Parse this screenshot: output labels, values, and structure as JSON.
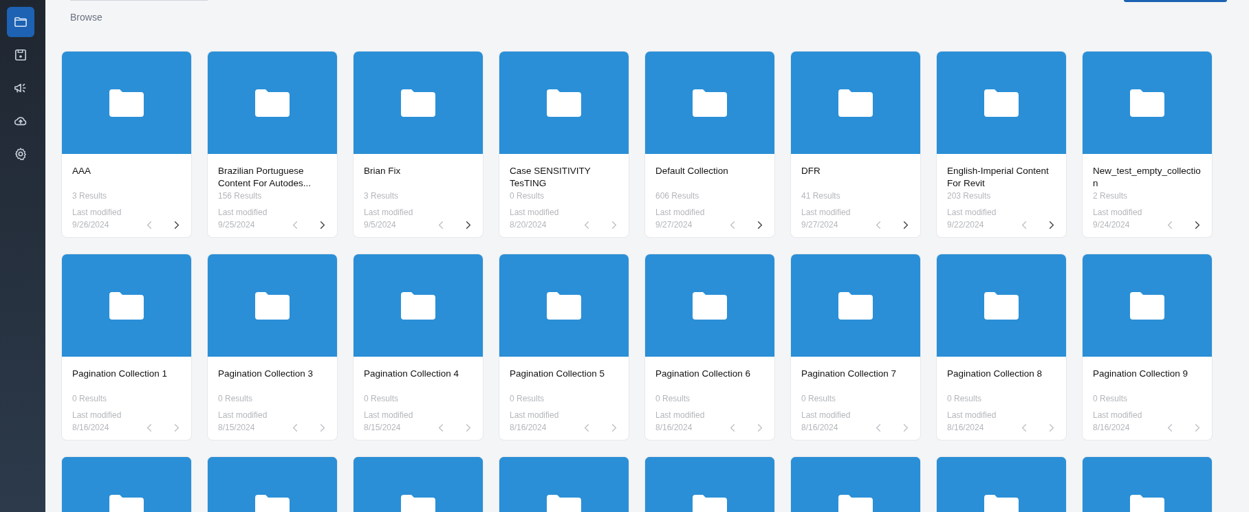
{
  "sidebar": {
    "items": [
      {
        "kind": "folder",
        "selected": true
      },
      {
        "kind": "save",
        "selected": false
      },
      {
        "kind": "megaphone",
        "selected": false
      },
      {
        "kind": "upload",
        "selected": false
      },
      {
        "kind": "settings",
        "selected": false
      }
    ]
  },
  "header": {
    "title": "Browse"
  },
  "collections": [
    {
      "name": "AAA",
      "results": "3 Results",
      "modified_label": "Last modified",
      "modified": "9/26/2024",
      "prev_enabled": false,
      "next_enabled": true
    },
    {
      "name": "Brazilian Portuguese Content For Autodes...",
      "results": "156 Results",
      "modified_label": "Last modified",
      "modified": "9/25/2024",
      "prev_enabled": false,
      "next_enabled": true
    },
    {
      "name": "Brian Fix",
      "results": "3 Results",
      "modified_label": "Last modified",
      "modified": "9/5/2024",
      "prev_enabled": false,
      "next_enabled": true
    },
    {
      "name": "Case SENSITIVITY TesTING",
      "results": "0 Results",
      "modified_label": "Last modified",
      "modified": "8/20/2024",
      "prev_enabled": false,
      "next_enabled": false
    },
    {
      "name": "Default Collection",
      "results": "606 Results",
      "modified_label": "Last modified",
      "modified": "9/27/2024",
      "prev_enabled": false,
      "next_enabled": true
    },
    {
      "name": "DFR",
      "results": "41 Results",
      "modified_label": "Last modified",
      "modified": "9/27/2024",
      "prev_enabled": false,
      "next_enabled": true
    },
    {
      "name": "English-Imperial Content For Revit",
      "results": "203 Results",
      "modified_label": "Last modified",
      "modified": "9/22/2024",
      "prev_enabled": false,
      "next_enabled": true
    },
    {
      "name": "New_test_empty_collection",
      "results": "2 Results",
      "modified_label": "Last modified",
      "modified": "9/24/2024",
      "prev_enabled": false,
      "next_enabled": true
    },
    {
      "name": "Pagination Collection 1",
      "results": "0 Results",
      "modified_label": "Last modified",
      "modified": "8/16/2024",
      "prev_enabled": false,
      "next_enabled": false
    },
    {
      "name": "Pagination Collection 3",
      "results": "0 Results",
      "modified_label": "Last modified",
      "modified": "8/15/2024",
      "prev_enabled": false,
      "next_enabled": false
    },
    {
      "name": "Pagination Collection 4",
      "results": "0 Results",
      "modified_label": "Last modified",
      "modified": "8/15/2024",
      "prev_enabled": false,
      "next_enabled": false
    },
    {
      "name": "Pagination Collection 5",
      "results": "0 Results",
      "modified_label": "Last modified",
      "modified": "8/16/2024",
      "prev_enabled": false,
      "next_enabled": false
    },
    {
      "name": "Pagination Collection 6",
      "results": "0 Results",
      "modified_label": "Last modified",
      "modified": "8/16/2024",
      "prev_enabled": false,
      "next_enabled": false
    },
    {
      "name": "Pagination Collection 7",
      "results": "0 Results",
      "modified_label": "Last modified",
      "modified": "8/16/2024",
      "prev_enabled": false,
      "next_enabled": false
    },
    {
      "name": "Pagination Collection 8",
      "results": "0 Results",
      "modified_label": "Last modified",
      "modified": "8/16/2024",
      "prev_enabled": false,
      "next_enabled": false
    },
    {
      "name": "Pagination Collection 9",
      "results": "0 Results",
      "modified_label": "Last modified",
      "modified": "8/16/2024",
      "prev_enabled": false,
      "next_enabled": false
    },
    {
      "kind": "partial",
      "hovered": false
    },
    {
      "kind": "partial",
      "hovered": false
    },
    {
      "kind": "partial",
      "hovered": false
    },
    {
      "kind": "partial",
      "hovered": false
    },
    {
      "kind": "partial",
      "hovered": false
    },
    {
      "kind": "partial",
      "hovered": false
    },
    {
      "kind": "partial",
      "hovered": false
    },
    {
      "kind": "partial",
      "hovered": false
    }
  ]
}
